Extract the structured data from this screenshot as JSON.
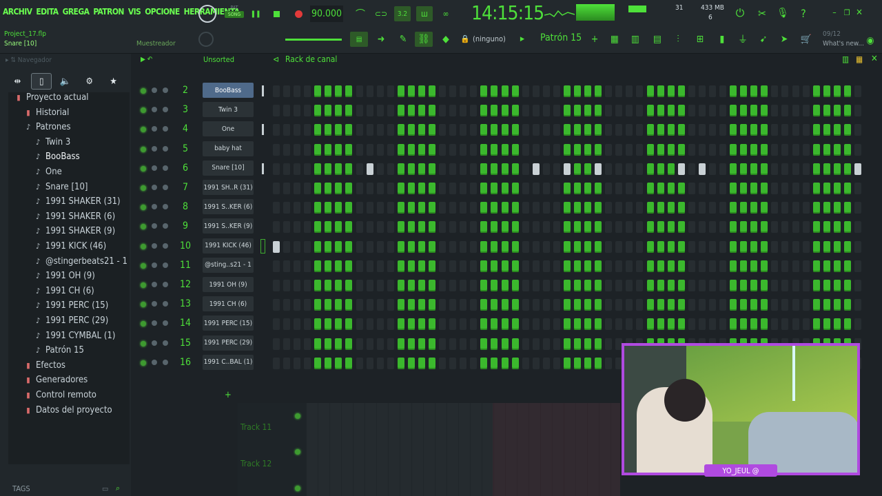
{
  "menu": [
    "ARCHIV",
    "EDITA",
    "GREGA",
    "PATRON",
    "VIS",
    "OPCIONE",
    "HERRAMIENTA"
  ],
  "transport": {
    "tempo": "90.000",
    "pat_label": "PAT",
    "song_label": "SONG",
    "time": "14:15:15",
    "mem": "433 MB",
    "cpu_num": "31",
    "cpu_small": "6"
  },
  "project": {
    "file": "Project_17.flp",
    "channel": "Snare [10]"
  },
  "toolbar": {
    "sampler_label": "Muestreador",
    "none_label": "(ninguno)",
    "pattern_label": "Patrón 15",
    "news_date": "09/12",
    "news_label": "What's new..."
  },
  "browser": {
    "title": "Navegador",
    "tags_label": "TAGS",
    "tree": [
      {
        "label": "Proyecto actual",
        "kind": "folder",
        "level": 0
      },
      {
        "label": "Historial",
        "kind": "folder",
        "level": 1
      },
      {
        "label": "Patrones",
        "kind": "note",
        "level": 1
      },
      {
        "label": "Twin 3",
        "kind": "note",
        "level": 2
      },
      {
        "label": "BooBass",
        "kind": "note",
        "level": 2,
        "selected": true
      },
      {
        "label": "One",
        "kind": "note",
        "level": 2
      },
      {
        "label": "Snare [10]",
        "kind": "note",
        "level": 2
      },
      {
        "label": "1991 SHAKER (31)",
        "kind": "note",
        "level": 2
      },
      {
        "label": "1991 SHAKER (6)",
        "kind": "note",
        "level": 2
      },
      {
        "label": "1991 SHAKER (9)",
        "kind": "note",
        "level": 2
      },
      {
        "label": "1991 KICK (46)",
        "kind": "note",
        "level": 2
      },
      {
        "label": "@stingerbeats21 - 1",
        "kind": "note",
        "level": 2
      },
      {
        "label": "1991 OH (9)",
        "kind": "note",
        "level": 2
      },
      {
        "label": "1991 CH (6)",
        "kind": "note",
        "level": 2
      },
      {
        "label": "1991 PERC (15)",
        "kind": "note",
        "level": 2
      },
      {
        "label": "1991 PERC (29)",
        "kind": "note",
        "level": 2
      },
      {
        "label": "1991 CYMBAL (1)",
        "kind": "note",
        "level": 2
      },
      {
        "label": "Patrón 15",
        "kind": "note",
        "level": 2
      },
      {
        "label": "Efectos",
        "kind": "folder",
        "level": 1
      },
      {
        "label": "Generadores",
        "kind": "folder",
        "level": 1
      },
      {
        "label": "Control remoto",
        "kind": "folder",
        "level": 1
      },
      {
        "label": "Datos del proyecto",
        "kind": "folder",
        "level": 1
      }
    ]
  },
  "rack": {
    "filter_label": "Unsorted",
    "title": "Rack de canal",
    "channels": [
      {
        "num": "2",
        "name": "BooBass",
        "selected": true,
        "mark": "bar"
      },
      {
        "num": "3",
        "name": "Twin 3"
      },
      {
        "num": "4",
        "name": "One",
        "mark": "bar"
      },
      {
        "num": "5",
        "name": "baby hat"
      },
      {
        "num": "6",
        "name": "Snare [10]",
        "mark": "bar",
        "white": [
          9,
          25,
          28,
          31,
          39,
          41,
          56
        ]
      },
      {
        "num": "7",
        "name": "1991 SH..R (31)"
      },
      {
        "num": "8",
        "name": "1991 S..KER (6)"
      },
      {
        "num": "9",
        "name": "1991 S..KER (9)"
      },
      {
        "num": "10",
        "name": "1991 KICK (46)",
        "mark": "box",
        "white": [
          0
        ]
      },
      {
        "num": "11",
        "name": "@sting..s21 - 1"
      },
      {
        "num": "12",
        "name": "1991 OH (9)"
      },
      {
        "num": "13",
        "name": "1991 CH (6)"
      },
      {
        "num": "14",
        "name": "1991 PERC (15)"
      },
      {
        "num": "15",
        "name": "1991 PERC (29)"
      },
      {
        "num": "16",
        "name": "1991 C..BAL (1)"
      }
    ]
  },
  "playlist": {
    "tracks": [
      "Track 11",
      "Track 12"
    ]
  },
  "webcam": {
    "label": "YO_JEUL @"
  },
  "colors": {
    "accent": "#4ee03a",
    "webcam_border": "#b04ae0"
  }
}
